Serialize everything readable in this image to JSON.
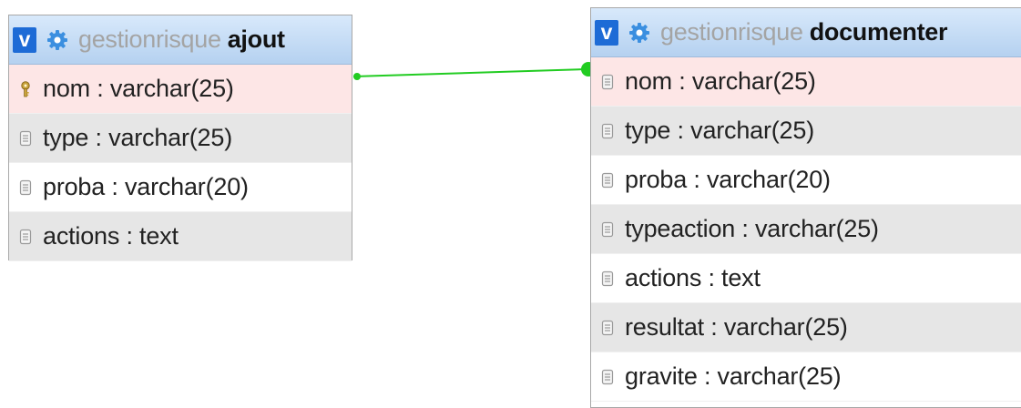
{
  "tables": [
    {
      "db": "gestionrisque",
      "name": "ajout",
      "toggle_label": "v",
      "columns": [
        {
          "text": "nom : varchar(25)",
          "icon": "key-icon",
          "style": "pk"
        },
        {
          "text": "type : varchar(25)",
          "icon": "column-icon",
          "style": "grey"
        },
        {
          "text": "proba : varchar(20)",
          "icon": "column-icon",
          "style": "white"
        },
        {
          "text": "actions : text",
          "icon": "column-icon",
          "style": "grey"
        }
      ]
    },
    {
      "db": "gestionrisque",
      "name": "documenter",
      "toggle_label": "v",
      "columns": [
        {
          "text": "nom : varchar(25)",
          "icon": "column-icon",
          "style": "pk"
        },
        {
          "text": "type : varchar(25)",
          "icon": "column-icon",
          "style": "grey"
        },
        {
          "text": "proba : varchar(20)",
          "icon": "column-icon",
          "style": "white"
        },
        {
          "text": "typeaction : varchar(25)",
          "icon": "column-icon",
          "style": "grey"
        },
        {
          "text": "actions : text",
          "icon": "column-icon",
          "style": "white"
        },
        {
          "text": "resultat : varchar(25)",
          "icon": "column-icon",
          "style": "grey"
        },
        {
          "text": "gravite : varchar(25)",
          "icon": "column-icon",
          "style": "white"
        }
      ]
    }
  ],
  "colors": {
    "relation_line": "#22cc22",
    "header_accent": "#1d6bd6",
    "gear": "#3b8fe0",
    "key": "#c9a23a",
    "pk_row": "#fde6e6",
    "alt_row": "#e6e6e6"
  }
}
